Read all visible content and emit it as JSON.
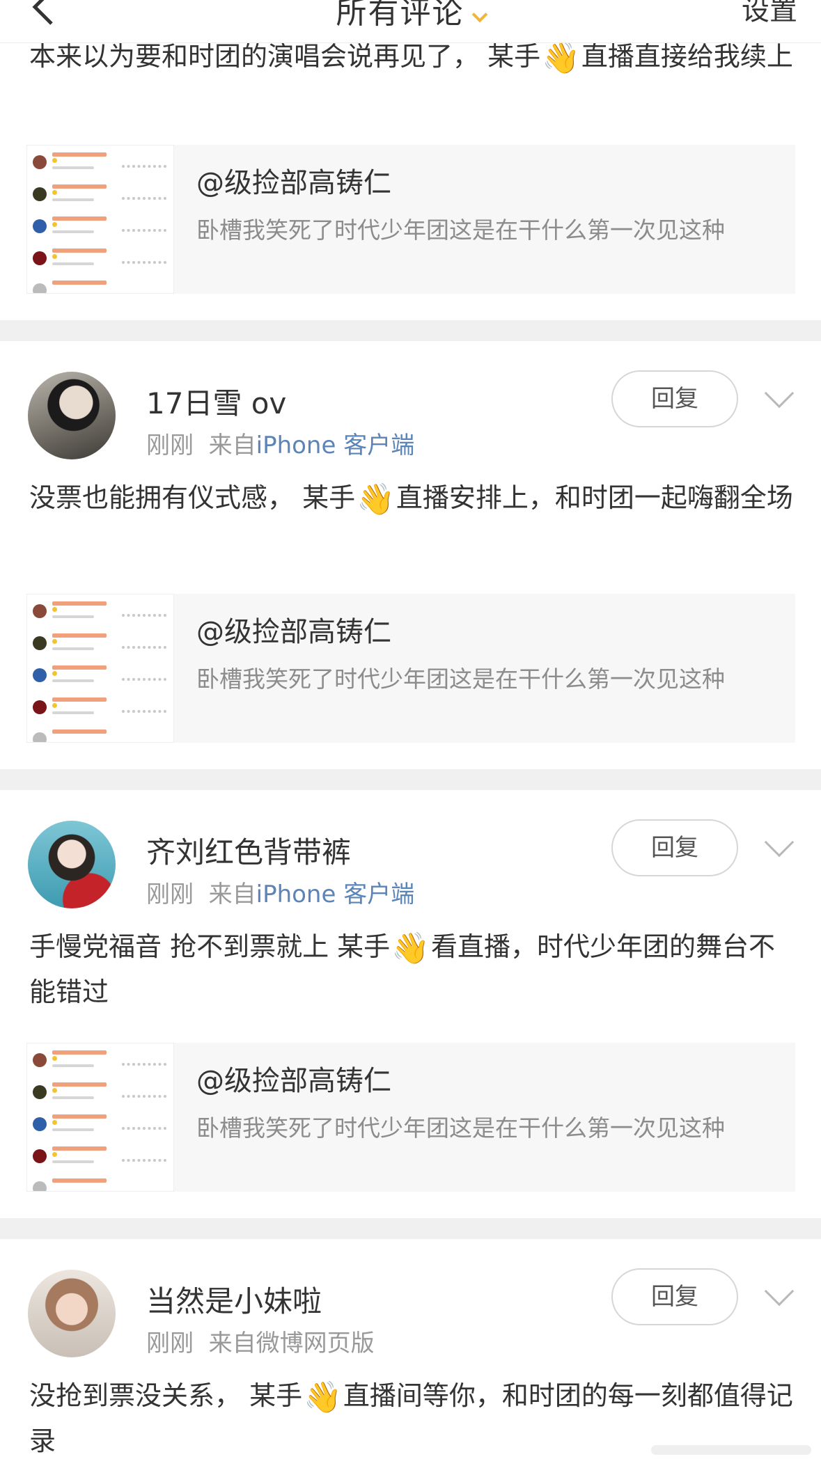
{
  "header": {
    "title": "所有评论",
    "settings_label": "设置"
  },
  "share_card": {
    "username": "@级捡部高铸仁",
    "description": "卧槽我笑死了时代少年团这是在干什么第一次见这种"
  },
  "partial_comment": {
    "text_before": "本来以为要和时团的演唱会说再见了， 某手",
    "text_after": "直播直接给我续上"
  },
  "comments": [
    {
      "username": "17日雪 ov",
      "time": "刚刚",
      "source_prefix": "来自",
      "source": "iPhone 客户端",
      "reply_label": "回复",
      "text_before": "没票也能拥有仪式感， 某手",
      "text_after": "直播安排上，和时团一起嗨翻全场"
    },
    {
      "username": "齐刘红色背带裤",
      "time": "刚刚",
      "source_prefix": "来自",
      "source": "iPhone 客户端",
      "reply_label": "回复",
      "text_before": "手慢党福音 抢不到票就上 某手",
      "text_after": "看直播，时代少年团的舞台不能错过"
    },
    {
      "username": "当然是小妹啦",
      "time": "刚刚",
      "source_prefix": "来自微博网页版",
      "source": "",
      "reply_label": "回复",
      "text_before": "没抢到票没关系， 某手",
      "text_after": "直播间等你，和时团的每一刻都值得记录"
    }
  ],
  "emoji": "👋",
  "icons": [
    "back-arrow-icon",
    "verified-badge-icon",
    "chevron-down-icon",
    "wave-hand-emoji"
  ]
}
